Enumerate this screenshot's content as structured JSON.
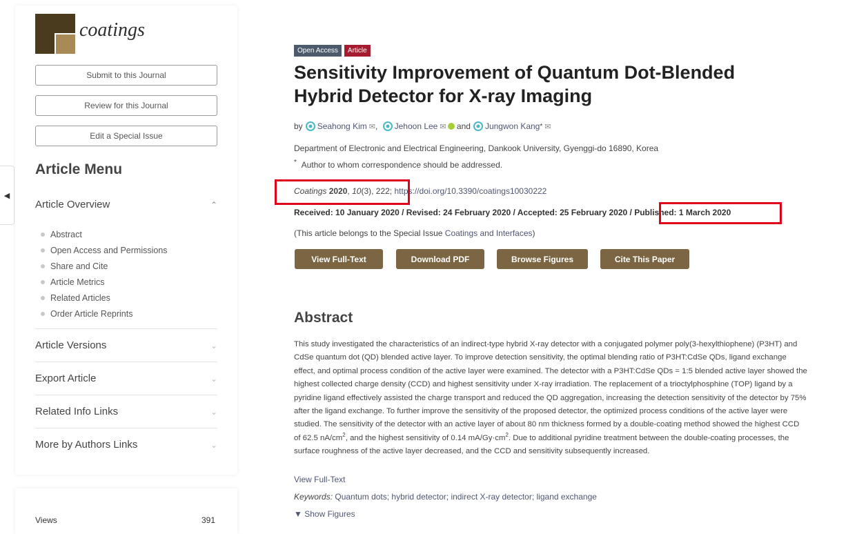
{
  "journal": {
    "name": "coatings"
  },
  "sidebar": {
    "buttons": [
      "Submit to this Journal",
      "Review for this Journal",
      "Edit a Special Issue"
    ],
    "menu_title": "Article Menu",
    "overview": {
      "label": "Article Overview",
      "items": [
        "Abstract",
        "Open Access and Permissions",
        "Share and Cite",
        "Article Metrics",
        "Related Articles",
        "Order Article Reprints"
      ]
    },
    "sections": [
      "Article Versions",
      "Export Article",
      "Related Info Links",
      "More by Authors Links"
    ],
    "views_label": "Views",
    "views_value": "391"
  },
  "article": {
    "badges": [
      "Open Access",
      "Article"
    ],
    "title": "Sensitivity Improvement of Quantum Dot-Blended Hybrid Detector for X-ray Imaging",
    "by": "by",
    "authors": [
      "Seahong Kim",
      "Jehoon Lee",
      "Jungwon Kang"
    ],
    "and": "and",
    "corr_mark": "*",
    "affiliation": "Department of Electronic and Electrical Engineering, Dankook University, Gyenggi-do 16890, Korea",
    "corresponding": "Author to whom correspondence should be addressed.",
    "citation": {
      "journal": "Coatings",
      "year": "2020",
      "volume": "10",
      "issue": "(3), 222;",
      "doi": "https://doi.org/10.3390/coatings10030222"
    },
    "dates": {
      "received": "Received: 10 January 2020",
      "revised": "Revised: 24 February 2020",
      "accepted": "Accepted: 25 February 2020",
      "published": "Published: 1 March 2020",
      "separator": " / "
    },
    "belongs_prefix": "(This article belongs to the Special Issue ",
    "belongs_link": "Coatings and Interfaces",
    "belongs_suffix": ")",
    "actions": [
      "View Full-Text",
      "Download PDF",
      "Browse Figures",
      "Cite This Paper"
    ]
  },
  "abstract": {
    "title": "Abstract",
    "text_1": "This study investigated the characteristics of an indirect-type hybrid X-ray detector with a conjugated polymer poly(3-hexylthiophene) (P3HT) and CdSe quantum dot (QD) blended active layer. To improve detection sensitivity, the optimal blending ratio of P3HT:CdSe QDs, ligand exchange effect, and optimal process condition of the active layer were examined. The detector with a P3HT:CdSe QDs = 1:5 blended active layer showed the highest collected charge density (CCD) and highest sensitivity under X-ray irradiation. The replacement of a trioctylphosphine (TOP) ligand by a pyridine ligand effectively assisted the charge transport and reduced the QD aggregation, increasing the detection sensitivity of the detector by 75% after the ligand exchange. To further improve the sensitivity of the proposed detector, the optimized process conditions of the active layer were studied. The sensitivity of the detector with an active layer of about 80 nm thickness formed by a double-coating method showed the highest CCD of 62.5 nA/cm",
    "sup_1": "2",
    "text_2": ", and the highest sensitivity of 0.14 mA/Gy·cm",
    "sup_2": "2",
    "text_3": ". Due to additional pyridine treatment between the double-coating processes, the surface roughness of the active layer decreased, and the CCD and sensitivity subsequently increased.",
    "view_full": "View Full-Text",
    "keywords_label": "Keywords:",
    "keywords": "Quantum dots; hybrid detector; indirect X-ray detector; ligand exchange",
    "show_figures": "▼ Show Figures"
  },
  "colors": {
    "brand_dark": "#4a3a1e",
    "brand_light": "#a88a56",
    "action_button": "#7b6542",
    "highlight_box": "#e0001a",
    "open_access_badge": "#4d5a6b",
    "article_badge": "#a51c30"
  }
}
